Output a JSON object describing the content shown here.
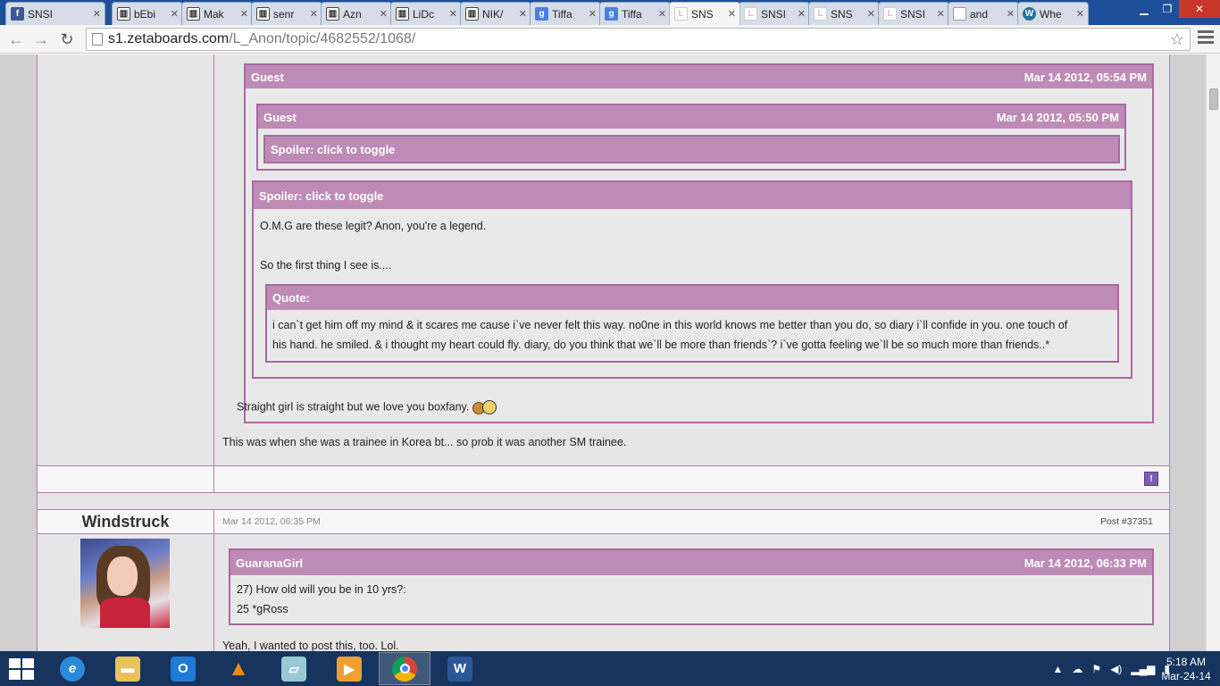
{
  "browser": {
    "tabs": [
      {
        "title": "SNSI",
        "icon": "facebook-icon"
      },
      {
        "title": "bEbi",
        "icon": "tumblr-icon"
      },
      {
        "title": "Mak",
        "icon": "tumblr-icon"
      },
      {
        "title": "senr",
        "icon": "tumblr-icon"
      },
      {
        "title": "Azn",
        "icon": "tumblr-icon"
      },
      {
        "title": "LiDc",
        "icon": "tumblr-icon"
      },
      {
        "title": "NIK/",
        "icon": "tumblr-icon"
      },
      {
        "title": "Tiffa",
        "icon": "google-icon"
      },
      {
        "title": "Tiffa",
        "icon": "google-icon"
      },
      {
        "title": "SNS",
        "icon": "zetaboards-icon",
        "active": true
      },
      {
        "title": "SNSI",
        "icon": "zetaboards-icon"
      },
      {
        "title": "SNS",
        "icon": "zetaboards-icon"
      },
      {
        "title": "SNSI",
        "icon": "zetaboards-icon"
      },
      {
        "title": "and",
        "icon": "document-icon"
      },
      {
        "title": "Whe",
        "icon": "wordpress-icon"
      }
    ],
    "url_host": "s1.zetaboards.com",
    "url_path": "/L_Anon/topic/4682552/1068/"
  },
  "post1": {
    "outer_quote": {
      "author": "Guest",
      "date": "Mar 14 2012, 05:54 PM"
    },
    "inner_quote": {
      "author": "Guest",
      "date": "Mar 14 2012, 05:50 PM",
      "spoiler": "Spoiler: click to toggle"
    },
    "spoiler2": {
      "title": "Spoiler: click to toggle",
      "line1": "O.M.G are these legit? Anon, you're a legend.",
      "line2": "So the first thing I see is....",
      "quote_title": "Quote:",
      "quote_line1": "i can`t get him off my mind & it scares me cause i`ve never felt this way. no0ne in this world knows me better than you do, so diary i`ll confide in you. one touch of",
      "quote_line2": "his hand. he smiled. & i thought my heart could fly. diary, do you think that we`ll be more than friends`? i`ve gotta feeling we`ll be so much more than friends..*"
    },
    "outer_text": "Straight girl is straight but we love you boxfany.",
    "reply": "This was when she was a trainee in Korea bt... so prob it was another SM trainee.",
    "report_label": "!"
  },
  "post2": {
    "username": "Windstruck",
    "date": "Mar 14 2012, 06:35 PM",
    "post_number": "Post #37351",
    "quote": {
      "author": "GuaranaGirl",
      "date": "Mar 14 2012, 06:33 PM",
      "line1": "27) How old will you be in 10 yrs?:",
      "line2": "25 *gRoss"
    },
    "reply": "Yeah, I wanted to post this, too. Lol."
  },
  "taskbar": {
    "apps": [
      {
        "name": "internet-explorer",
        "icon": "ie-icon"
      },
      {
        "name": "file-explorer",
        "icon": "folder-icon"
      },
      {
        "name": "outlook",
        "icon": "outlook-icon"
      },
      {
        "name": "vlc",
        "icon": "vlc-icon"
      },
      {
        "name": "notes",
        "icon": "notes-icon"
      },
      {
        "name": "media-player",
        "icon": "media-icon"
      },
      {
        "name": "chrome",
        "icon": "chrome-icon",
        "active": true
      },
      {
        "name": "word",
        "icon": "word-icon"
      }
    ],
    "time": "5:18 AM",
    "date": "Mar-24-14"
  },
  "colors": {
    "quote_header": "#be8bb7",
    "quote_border": "#a9699f",
    "taskbar": "#16345e",
    "tabstrip": "#1e4f9a"
  }
}
